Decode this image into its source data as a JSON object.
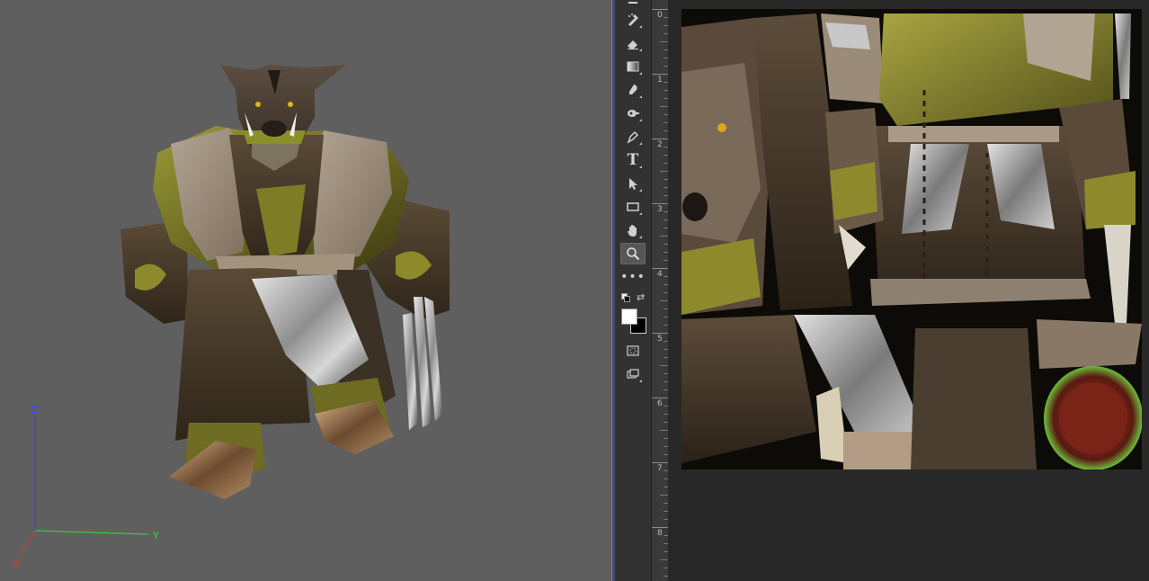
{
  "viewport": {
    "axes": {
      "x_label": "X",
      "y_label": "Y",
      "z_label": "Z"
    },
    "axis_colors": {
      "x": "#d83a2a",
      "y": "#2ee12e",
      "z": "#2f3fd8"
    },
    "background_color": "#5f5f5f",
    "model": "boar-warrior-character"
  },
  "toolbar": {
    "tools": [
      {
        "name": "brush-tool",
        "icon": "healing-brush-icon"
      },
      {
        "name": "eraser-tool",
        "icon": "eraser-icon"
      },
      {
        "name": "gradient-tool",
        "icon": "gradient-icon"
      },
      {
        "name": "blur-tool",
        "icon": "smudge-icon"
      },
      {
        "name": "dodge-tool",
        "icon": "dodge-icon"
      },
      {
        "name": "pen-tool",
        "icon": "pen-icon"
      },
      {
        "name": "type-tool",
        "icon": "type-icon",
        "glyph": "T"
      },
      {
        "name": "path-selection-tool",
        "icon": "arrow-select-icon"
      },
      {
        "name": "rectangle-tool",
        "icon": "rectangle-icon"
      },
      {
        "name": "hand-tool",
        "icon": "hand-icon"
      },
      {
        "name": "zoom-tool",
        "icon": "zoom-icon",
        "active": true
      },
      {
        "name": "more-tools",
        "icon": "more-icon",
        "glyph": "•••"
      }
    ],
    "foreground_color": "#ffffff",
    "background_color": "#000000"
  },
  "ruler": {
    "labels": [
      "0",
      "1",
      "2",
      "3",
      "4",
      "5",
      "6",
      "7",
      "8"
    ]
  },
  "canvas": {
    "content": "character-texture-map"
  }
}
